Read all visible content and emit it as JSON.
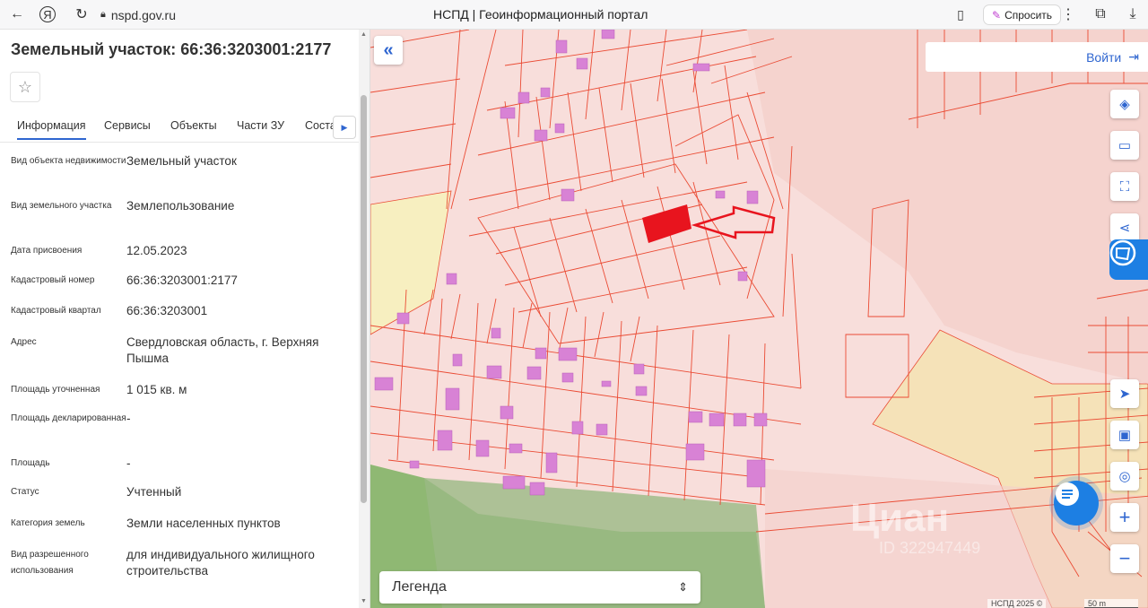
{
  "browser": {
    "back_icon": "arrow-left-icon",
    "url": "nspd.gov.ru",
    "title": "НСПД | Геоинформационный портал",
    "ask_label": "Спросить"
  },
  "panel": {
    "title": "Земельный участок: 66:36:3203001:2177",
    "tabs": [
      {
        "label": "Информация",
        "active": true
      },
      {
        "label": "Сервисы"
      },
      {
        "label": "Объекты"
      },
      {
        "label": "Части ЗУ"
      },
      {
        "label": "Соста"
      }
    ],
    "rows": [
      {
        "label": "Вид объекта недвижимости",
        "value": "Земельный участок"
      },
      {
        "label": "Вид земельного участка",
        "value": "Землепользование"
      },
      {
        "label": "Дата присвоения",
        "value": "12.05.2023"
      },
      {
        "label": "Кадастровый номер",
        "value": "66:36:3203001:2177"
      },
      {
        "label": "Кадастровый квартал",
        "value": "66:36:3203001"
      },
      {
        "label": "Адрес",
        "value": "Свердловская область, г. Верхняя Пышма"
      },
      {
        "label": "Площадь уточненная",
        "value": "1 015 кв. м"
      },
      {
        "label": "Площадь декларированная",
        "value": "-"
      },
      {
        "label": "Площадь",
        "value": "-"
      },
      {
        "label": "Статус",
        "value": "Учтенный"
      },
      {
        "label": "Категория земель",
        "value": "Земли населенных пунктов"
      },
      {
        "label": "Вид разрешенного использования",
        "value": "для индивидуального жилищного строительства"
      }
    ]
  },
  "map": {
    "login_label": "Войти",
    "legend_label": "Легенда",
    "watermark": "Циан",
    "watermark_id": "ID 322947449",
    "attribution": "НСПД 2025 ©",
    "scale_label": "50 m",
    "colors": {
      "parcel_fill": "#f8dedb",
      "parcel_line": "#ea4b34",
      "selected": "#e8141e",
      "building": "#d882d5",
      "green": "#8fb873",
      "yellow": "#f7efc0",
      "accent": "#2f66d0"
    }
  }
}
